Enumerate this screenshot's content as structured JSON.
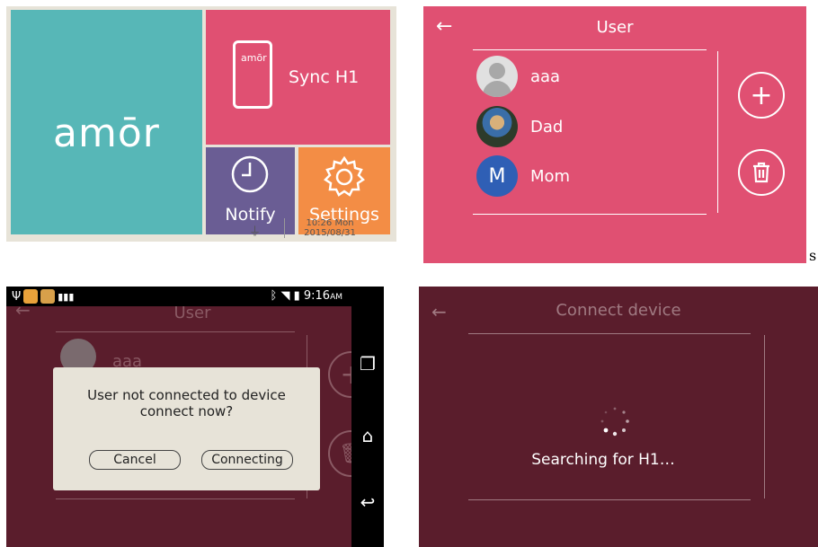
{
  "home": {
    "logo": "amōr",
    "sync": {
      "device_logo": "amōr",
      "label": "Sync H1"
    },
    "notify": {
      "label": "Notify"
    },
    "settings": {
      "label": "Settings"
    },
    "status": {
      "time": "10:26 Mon",
      "date": "2015/08/31"
    }
  },
  "user_screen": {
    "back": "←",
    "title": "User",
    "users": [
      {
        "name": "aaa"
      },
      {
        "name": "Dad"
      },
      {
        "name": "Mom",
        "initial": "M"
      }
    ],
    "add": "+",
    "delete": "🗑"
  },
  "dialog_screen": {
    "status_time": "9:16",
    "status_ampm": "AM",
    "bg_title": "User",
    "bg_user": "aaa",
    "message_line1": "User not connected to device",
    "message_line2": "connect now?",
    "cancel": "Cancel",
    "connecting": "Connecting"
  },
  "connect_screen": {
    "back": "←",
    "title": "Connect device",
    "status": "Searching for H1…"
  },
  "stray_char": "s",
  "colors": {
    "teal": "#57b7b7",
    "pink": "#e05072",
    "purple": "#6a5d94",
    "orange": "#f38d45",
    "maroon": "#5a1d2c"
  }
}
